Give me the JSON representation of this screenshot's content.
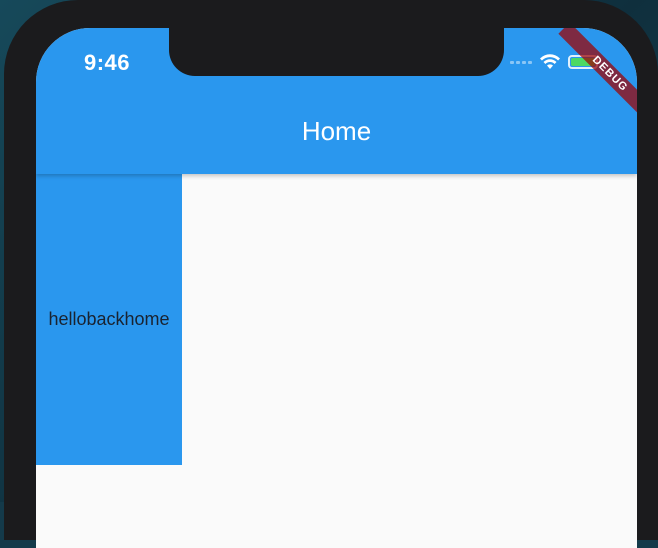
{
  "status_bar": {
    "time": "9:46",
    "icons": [
      "cellular-signal-icon",
      "wifi-icon",
      "battery-charging-icon"
    ]
  },
  "app_bar": {
    "title": "Home",
    "color": "#2a97ee"
  },
  "debug_banner": {
    "label": "DEBUG"
  },
  "content": {
    "box_label": "hellobackhome",
    "box_color": "#2a97ee",
    "background": "#fafafa"
  },
  "device": {
    "frame_color": "#1b1b1d"
  }
}
